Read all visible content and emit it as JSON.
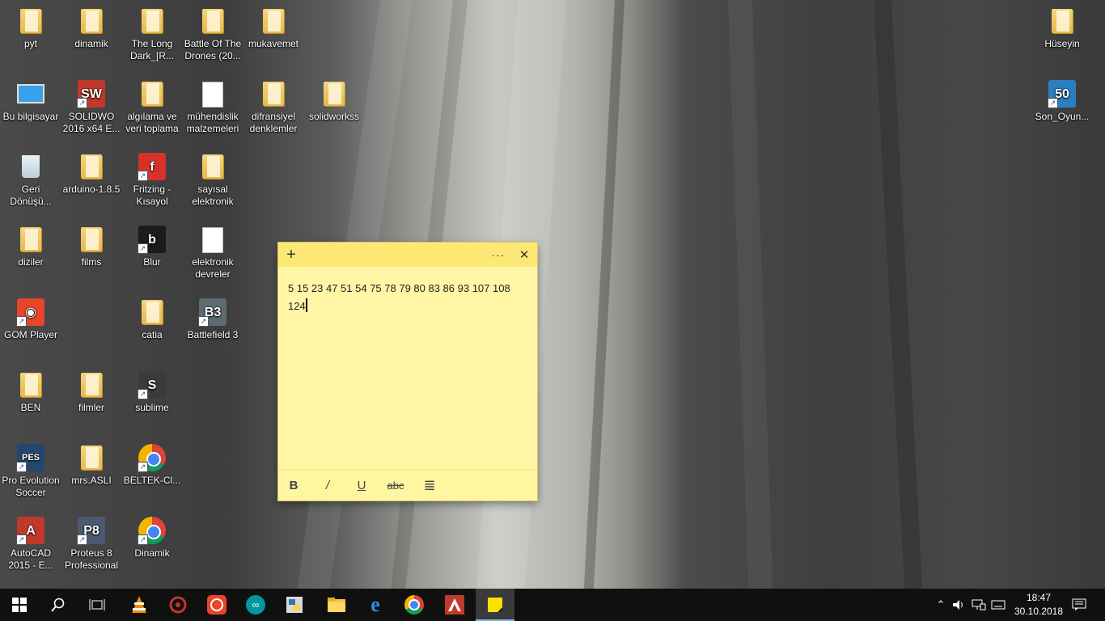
{
  "desktop": {
    "icons": [
      {
        "label": "pyt",
        "kind": "folder"
      },
      {
        "label": "dinamik",
        "kind": "folder"
      },
      {
        "label": "The Long Dark_[R...",
        "kind": "folder"
      },
      {
        "label": "Battle Of The Drones (20...",
        "kind": "folder"
      },
      {
        "label": "mukavemet",
        "kind": "folder"
      },
      {
        "label": "Hüseyin",
        "kind": "user-folder"
      },
      {
        "label": "Bu bilgisayar",
        "kind": "computer"
      },
      {
        "label": "SOLIDWO 2016 x64 E...",
        "kind": "app"
      },
      {
        "label": "algılama ve veri toplama",
        "kind": "folder"
      },
      {
        "label": "mühendislik malzemeleri",
        "kind": "file"
      },
      {
        "label": "difransiyel denklemler",
        "kind": "folder"
      },
      {
        "label": "solidworkss",
        "kind": "folder"
      },
      {
        "label": "Son_Oyun...",
        "kind": "app"
      },
      {
        "label": "Geri Dönüşü...",
        "kind": "recycle-bin"
      },
      {
        "label": "arduino-1.8.5",
        "kind": "folder"
      },
      {
        "label": "Fritzing - Kısayol",
        "kind": "app"
      },
      {
        "label": "sayısal elektronik",
        "kind": "folder"
      },
      {
        "label": "diziler",
        "kind": "folder"
      },
      {
        "label": "films",
        "kind": "folder"
      },
      {
        "label": "Blur",
        "kind": "app"
      },
      {
        "label": "elektronik devreler",
        "kind": "file"
      },
      {
        "label": "GOM Player",
        "kind": "app"
      },
      {
        "label": "catia",
        "kind": "folder"
      },
      {
        "label": "Battlefield 3",
        "kind": "app"
      },
      {
        "label": "BEN",
        "kind": "folder"
      },
      {
        "label": "filmler",
        "kind": "folder"
      },
      {
        "label": "sublime",
        "kind": "app"
      },
      {
        "label": "Pro Evolution Soccer",
        "kind": "app"
      },
      {
        "label": "mrs.ASLI",
        "kind": "folder"
      },
      {
        "label": "BELTEK-Cl...",
        "kind": "app"
      },
      {
        "label": "AutoCAD 2015 - E...",
        "kind": "app"
      },
      {
        "label": "Proteus 8 Professional",
        "kind": "app"
      },
      {
        "label": "Dinamik",
        "kind": "app"
      }
    ]
  },
  "sticky_note": {
    "add_glyph": "+",
    "menu_glyph": "···",
    "close_glyph": "✕",
    "line1": "5 15 23 47 51 54 75 78 79 80 83 86 93 107 108",
    "line2": "124",
    "format": {
      "bold": "B",
      "italic": "/",
      "underline": "U",
      "strikethrough": "abc",
      "list": "≣"
    }
  },
  "taskbar": {
    "pinned": [
      "start",
      "search",
      "task-view",
      "vlc",
      "app-red",
      "gom",
      "arduino",
      "python",
      "file-explorer",
      "edge",
      "chrome",
      "autocad",
      "sticky-notes"
    ],
    "tray": {
      "up_arrow": "⌃",
      "volume": "🔊"
    },
    "time": "18:47",
    "date": "30.10.2018"
  },
  "colors": {
    "note_bg": "#fff7a6",
    "note_title": "#fde876",
    "taskbar": "#101010",
    "active_accent": "#76b9ed"
  }
}
